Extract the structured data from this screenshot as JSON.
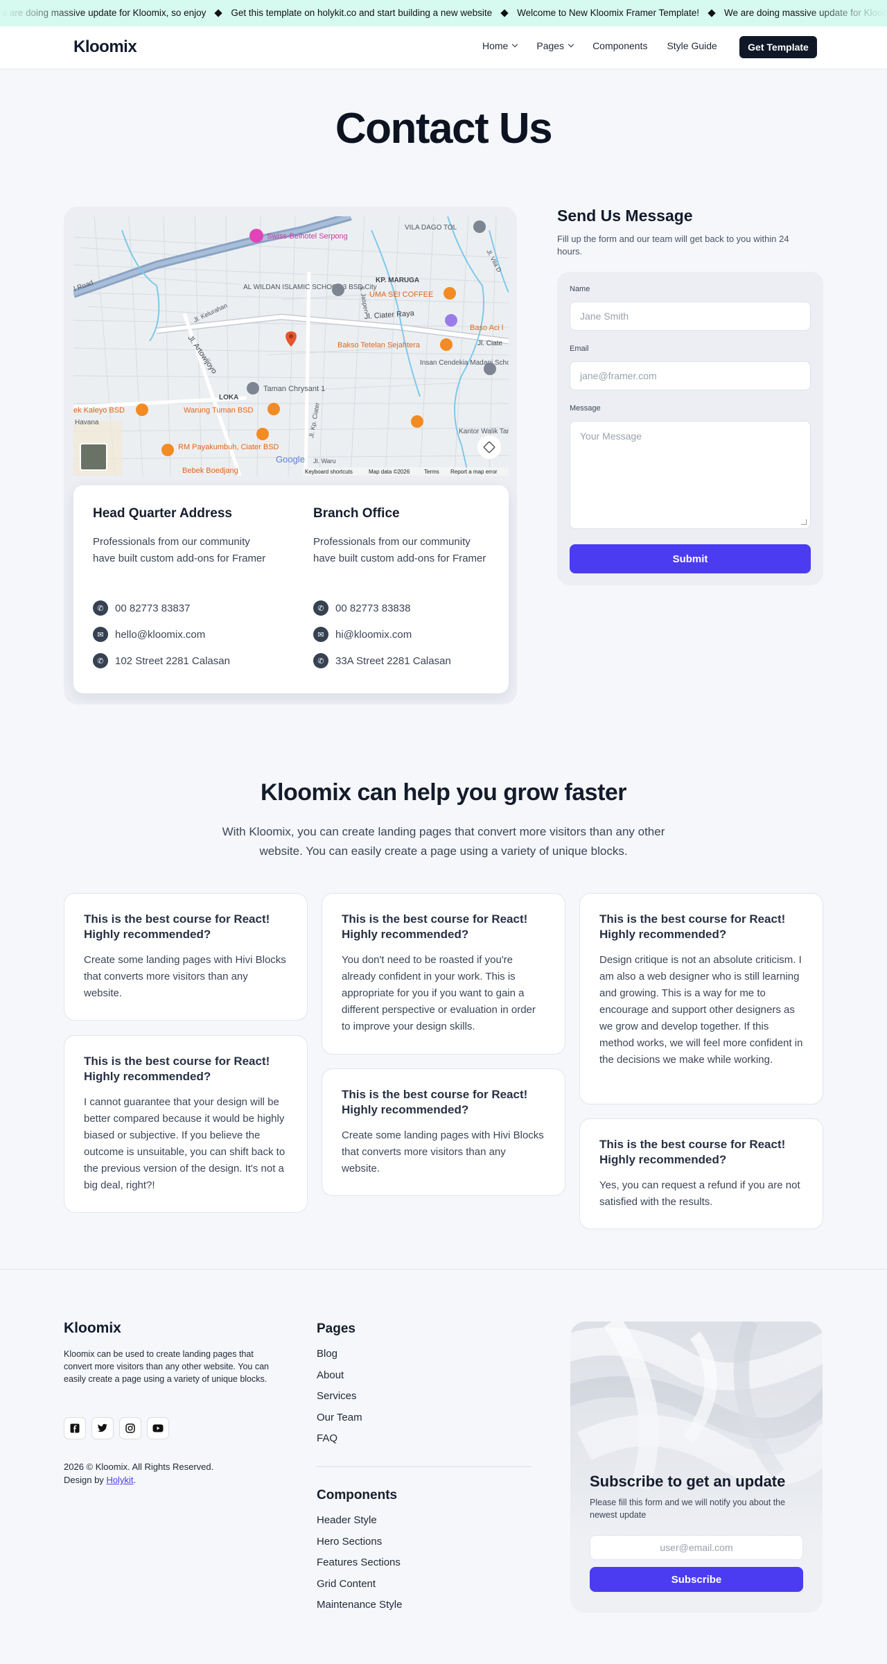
{
  "announcement": {
    "items": [
      "We are doing massive update for Kloomix, so enjoy",
      "Get this template on holykit.co and start building a new website",
      "Welcome to New Kloomix Framer Template!",
      "We are doing massive update for Kloomix, so enjoy"
    ]
  },
  "nav": {
    "logo": "Kloomix",
    "links": [
      {
        "label": "Home",
        "has_dropdown": true
      },
      {
        "label": "Pages",
        "has_dropdown": true
      },
      {
        "label": "Components",
        "has_dropdown": false
      },
      {
        "label": "Style Guide",
        "has_dropdown": false
      }
    ],
    "cta": "Get Template"
  },
  "page_title": "Contact Us",
  "map": {
    "labels": {
      "hotel": "Swiss-Belhotel Serpong",
      "vila": "VILA DAGO TOL",
      "road1": "Jl. Vila D",
      "road2": "l Road",
      "school": "AL WILDAN ISLAMIC SCHOOL 3 BSD City",
      "maruga": "KP. MARUGA",
      "uma": "UMA SEI COFFEE",
      "raya": "Jl. Ciater Raya",
      "baso": "Baso Aci l",
      "ciater": "Jl. Ciate",
      "kelurahan": "Jl. Kelurahan",
      "artowijoyo": "Jl. Artowijoyo",
      "jaspen": "Jl. Jaspen",
      "bakso": "Bakso Tetelan Sejahtera",
      "insan": "Insan Cendekia Madani School",
      "taman": "Taman Chrysant 1",
      "loka": "LOKA",
      "kaleyo": "ek Kaleyo BSD",
      "warung": "Warung Tuman BSD",
      "havana": "Havana",
      "rm": "RM Payakumbuh, Ciater BSD",
      "bebek": "Bebek Boedjang",
      "kantor": "Kantor Walik Tangera",
      "waru": "Jl. Waru",
      "kp": "Jl. Kp. Ciater",
      "google": "Google",
      "shortcuts": "Keyboard shortcuts",
      "mapdata": "Map data ©2026",
      "terms": "Terms",
      "report": "Report a map error"
    }
  },
  "offices": [
    {
      "title": "Head Quarter Address",
      "description": "Professionals from our community have built custom add-ons for Framer",
      "phone": "00 82773 83837",
      "email": "hello@kloomix.com",
      "address": "102 Street 2281 Calasan"
    },
    {
      "title": "Branch Office",
      "description": "Professionals from our community have built custom add-ons for Framer",
      "phone": "00 82773 83838",
      "email": "hi@kloomix.com",
      "address": "33A Street 2281 Calasan"
    }
  ],
  "contact_form": {
    "title": "Send Us Message",
    "subtitle": "Fill up the form and our team will get back to you within 24 hours.",
    "name_label": "Name",
    "name_placeholder": "Jane Smith",
    "email_label": "Email",
    "email_placeholder": "jane@framer.com",
    "message_label": "Message",
    "message_placeholder": "Your Message",
    "submit": "Submit"
  },
  "grow": {
    "title": "Kloomix can help you grow faster",
    "subtitle": "With Kloomix, you can create landing pages that convert more visitors than any other website. You can easily create a page using a variety of unique blocks."
  },
  "testimonials": [
    {
      "title": "This is the best course for React! Highly recommended?",
      "text": "Create some landing pages with Hivi Blocks that converts more visitors than any website."
    },
    {
      "title": "This is the best course for React! Highly recommended?",
      "text": "I cannot guarantee that your design will be better compared because it would be highly biased or subjective. If you believe the outcome is unsuitable, you can shift back to the previous version of the design. It's not a big deal, right?!"
    },
    {
      "title": "This is the best course for React! Highly recommended?",
      "text": "You don't need to be roasted if you're already confident in your work. This is appropriate for you if you want to gain a different perspective or evaluation in order to improve your design skills."
    },
    {
      "title": "This is the best course for React! Highly recommended?",
      "text": "Create some landing pages with Hivi Blocks that converts more visitors than any website."
    },
    {
      "title": "This is the best course for React! Highly recommended?",
      "text": "Design critique is not an absolute criticism. I am also a web designer who is still learning and growing. This is a way for me to encourage and support other designers as we grow and develop together. If this method works, we will feel more confident in the decisions we make while working."
    },
    {
      "title": "This is the best course for React! Highly recommended?",
      "text": "Yes, you can request a refund if you are not satisfied with the results."
    }
  ],
  "footer": {
    "logo": "Kloomix",
    "description": "Kloomix can be used to create landing pages that convert more visitors than any other website. You can easily create a page using a variety of unique blocks.",
    "socials": [
      "facebook-icon",
      "twitter-icon",
      "instagram-icon",
      "youtube-icon"
    ],
    "copyright": "2026 © Kloomix. All Rights Reserved.",
    "design_by": "Design by",
    "design_link": "Holykit",
    "design_end": ".",
    "pages_title": "Pages",
    "pages": [
      "Blog",
      "About",
      "Services",
      "Our Team",
      "FAQ"
    ],
    "components_title": "Components",
    "components": [
      "Header Style",
      "Hero Sections",
      "Features Sections",
      "Grid Content",
      "Maintenance Style"
    ],
    "subscribe": {
      "title": "Subscribe to get an update",
      "text": "Please fill this form and we will notify you about the newest update",
      "placeholder": "user@email.com",
      "button": "Subscribe"
    }
  },
  "colors": {
    "accent": "#4b3cf1",
    "dark": "#101828",
    "ticker_bg": "#d6f9f0"
  }
}
